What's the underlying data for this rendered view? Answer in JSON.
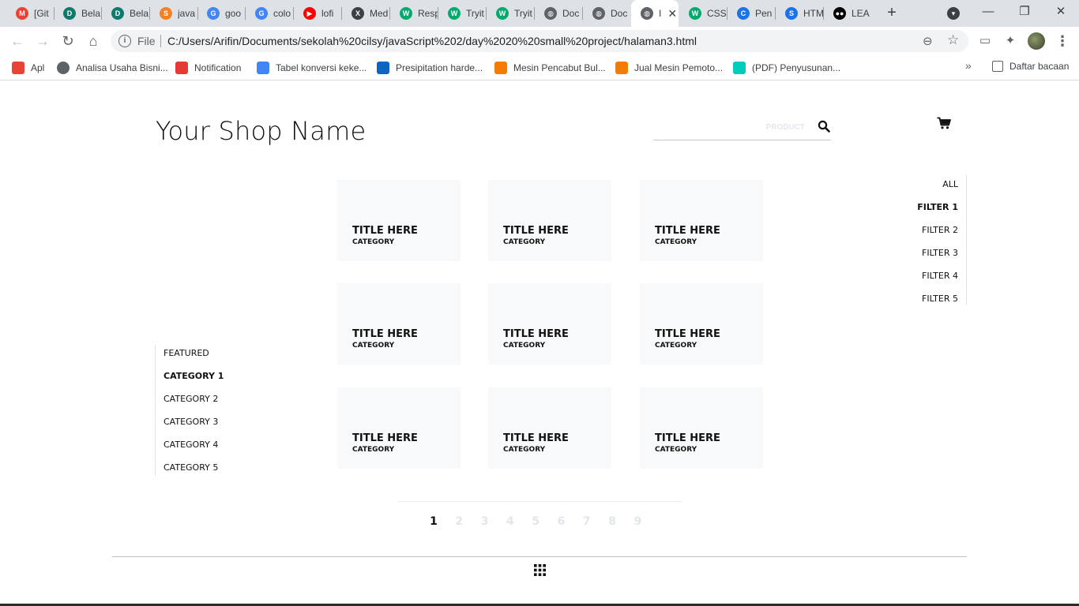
{
  "browser": {
    "tabs": [
      {
        "title": "[Git",
        "fav_color": "#ea4335",
        "fav_text": "M"
      },
      {
        "title": "Bela",
        "fav_color": "#0d7a6b",
        "fav_text": "D"
      },
      {
        "title": "Bela",
        "fav_color": "#0d7a6b",
        "fav_text": "D"
      },
      {
        "title": "java",
        "fav_color": "#f48024",
        "fav_text": "S"
      },
      {
        "title": "goo",
        "fav_color": "#4285f4",
        "fav_text": "G"
      },
      {
        "title": "colo",
        "fav_color": "#4285f4",
        "fav_text": "G"
      },
      {
        "title": "lofi",
        "fav_color": "#ff0000",
        "fav_text": "▶"
      },
      {
        "title": "Med",
        "fav_color": "#3c4043",
        "fav_text": "X"
      },
      {
        "title": "Resp",
        "fav_color": "#04aa6d",
        "fav_text": "W"
      },
      {
        "title": "Tryit",
        "fav_color": "#04aa6d",
        "fav_text": "W"
      },
      {
        "title": "Tryit",
        "fav_color": "#04aa6d",
        "fav_text": "W"
      },
      {
        "title": "Doc",
        "fav_color": "#5f6368",
        "fav_text": "◍"
      },
      {
        "title": "Doc",
        "fav_color": "#5f6368",
        "fav_text": "◍"
      },
      {
        "title": "I",
        "fav_color": "#5f6368",
        "fav_text": "◍",
        "active": true
      },
      {
        "title": "CSS",
        "fav_color": "#04aa6d",
        "fav_text": "W"
      },
      {
        "title": "Pen",
        "fav_color": "#1a73e8",
        "fav_text": "C"
      },
      {
        "title": "HTM",
        "fav_color": "#1a73e8",
        "fav_text": "S"
      },
      {
        "title": "LEA",
        "fav_color": "#000000",
        "fav_text": "●●"
      }
    ],
    "url_scheme": "File",
    "url": "C:/Users/Arifin/Documents/sekolah%20cilsy/javaScript%202/day%2020%20small%20project/halaman3.html",
    "bookmarks": [
      {
        "label": "Apl",
        "icon_color": "#ea4335"
      },
      {
        "label": "Analisa Usaha Bisni...",
        "icon_color": "#5f6368"
      },
      {
        "label": "Notification",
        "icon_color": "#e53935"
      },
      {
        "label": "Tabel konversi keke...",
        "icon_color": "#4285f4"
      },
      {
        "label": "Presipitation harde...",
        "icon_color": "#0a66c2"
      },
      {
        "label": "Mesin Pencabut Bul...",
        "icon_color": "#f57c00"
      },
      {
        "label": "Jual Mesin Pemoto...",
        "icon_color": "#f57c00"
      },
      {
        "label": "(PDF) Penyusunan...",
        "icon_color": "#00ccbb"
      }
    ],
    "reading_list": "Daftar bacaan",
    "more_bookmarks": "»"
  },
  "shop": {
    "name": "Your Shop Name",
    "search_placeholder": "PRODUCT",
    "filters": [
      "ALL",
      "FILTER 1",
      "FILTER 2",
      "FILTER 3",
      "FILTER 4",
      "FILTER 5"
    ],
    "active_filter": "FILTER 1",
    "categories": [
      "FEATURED",
      "CATEGORY 1",
      "CATEGORY 2",
      "CATEGORY 3",
      "CATEGORY 4",
      "CATEGORY 5"
    ],
    "active_category": "CATEGORY 1",
    "products": [
      {
        "title": "TITLE HERE",
        "category": "CATEGORY"
      },
      {
        "title": "TITLE HERE",
        "category": "CATEGORY"
      },
      {
        "title": "TITLE HERE",
        "category": "CATEGORY"
      },
      {
        "title": "TITLE HERE",
        "category": "CATEGORY"
      },
      {
        "title": "TITLE HERE",
        "category": "CATEGORY"
      },
      {
        "title": "TITLE HERE",
        "category": "CATEGORY"
      },
      {
        "title": "TITLE HERE",
        "category": "CATEGORY"
      },
      {
        "title": "TITLE HERE",
        "category": "CATEGORY"
      },
      {
        "title": "TITLE HERE",
        "category": "CATEGORY"
      }
    ],
    "pages": [
      "1",
      "2",
      "3",
      "4",
      "5",
      "6",
      "7",
      "8",
      "9"
    ],
    "current_page": "1"
  },
  "icons": {
    "search": "search-icon",
    "cart": "cart-icon",
    "menu_grid": "grid-icon"
  }
}
